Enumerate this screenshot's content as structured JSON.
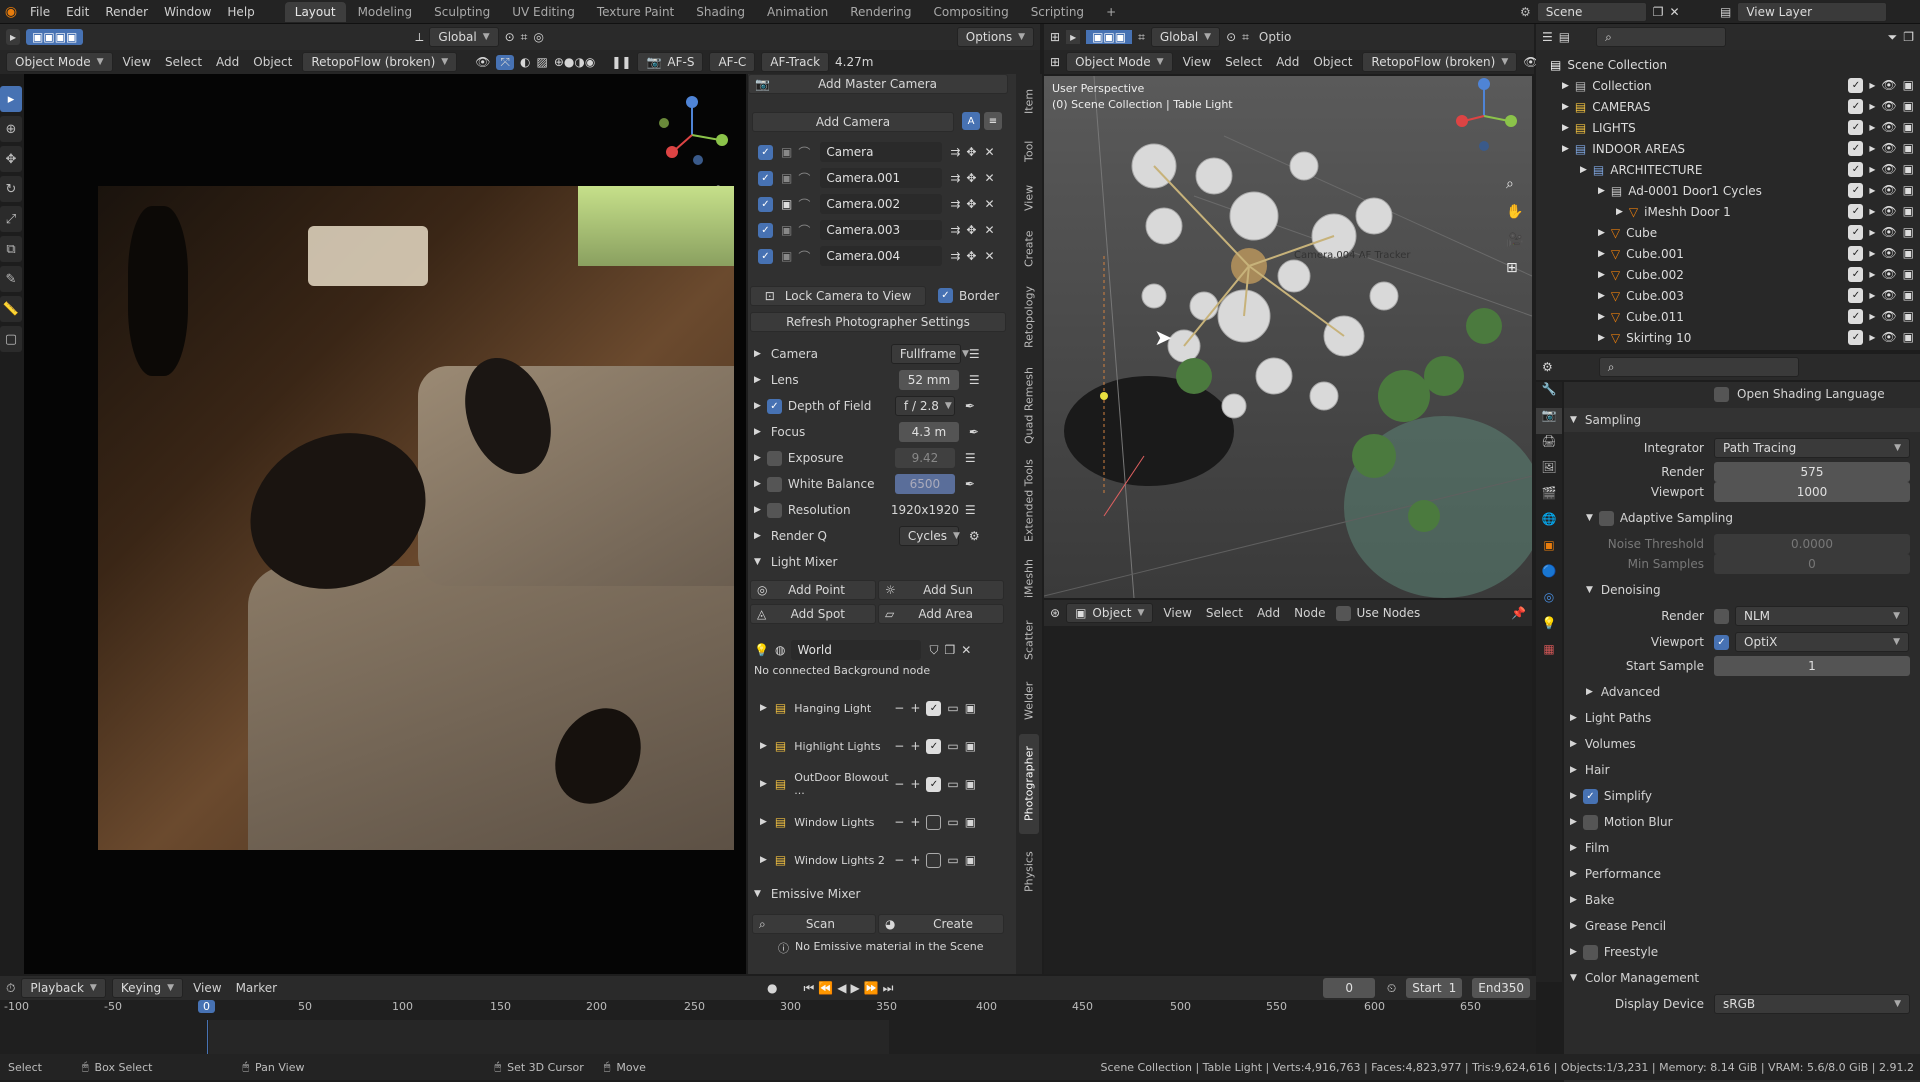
{
  "menu": [
    "File",
    "Edit",
    "Render",
    "Window",
    "Help"
  ],
  "workspaces": [
    "Layout",
    "Modeling",
    "Sculpting",
    "UV Editing",
    "Texture Paint",
    "Shading",
    "Animation",
    "Rendering",
    "Compositing",
    "Scripting"
  ],
  "active_workspace": "Layout",
  "scene": "Scene",
  "view_layer": "View Layer",
  "vp1": {
    "global": "Global",
    "options": "Options",
    "mode": "Object Mode",
    "menus": [
      "View",
      "Select",
      "Add",
      "Object"
    ],
    "retopo": "RetopoFlow (broken)",
    "af_s": "AF-S",
    "af_c": "AF-C",
    "af_track": "AF-Track",
    "distance": "4.27m"
  },
  "panel": {
    "add_master_camera": "Add Master Camera",
    "add_camera": "Add Camera",
    "cameras": [
      "Camera",
      "Camera.001",
      "Camera.002",
      "Camera.003",
      "Camera.004"
    ],
    "lock_camera": "Lock Camera to View",
    "border": "Border",
    "refresh": "Refresh Photographer Settings",
    "props": [
      {
        "label": "Camera",
        "value": "Fullframe",
        "check": false
      },
      {
        "label": "Lens",
        "value": "52 mm",
        "check": false
      },
      {
        "label": "Depth of Field",
        "value": "f / 2.8",
        "check": true
      },
      {
        "label": "Focus",
        "value": "4.3 m",
        "check": false
      },
      {
        "label": "Exposure",
        "value": "9.42",
        "check": false
      },
      {
        "label": "White Balance",
        "value": "6500",
        "check": false
      },
      {
        "label": "Resolution",
        "value": "1920x1920",
        "check": false
      },
      {
        "label": "Render Q",
        "value": "Cycles",
        "check": false
      }
    ],
    "light_mixer": "Light Mixer",
    "add_point": "Add Point",
    "add_sun": "Add Sun",
    "add_spot": "Add Spot",
    "add_area": "Add Area",
    "world": "World",
    "no_bg": "No connected Background node",
    "lights": [
      "Hanging Light",
      "Highlight Lights",
      "OutDoor Blowout ...",
      "Window Lights",
      "Window Lights 2"
    ],
    "emissive_mixer": "Emissive Mixer",
    "scan": "Scan",
    "create": "Create",
    "no_emissive": "No Emissive material in the Scene"
  },
  "vtabs": [
    "Item",
    "Tool",
    "View",
    "Create",
    "Retopology",
    "Quad Remesh",
    "Extended Tools",
    "iMeshh",
    "Scatter",
    "Welder",
    "Photographer",
    "Physics"
  ],
  "vp2": {
    "mode": "Object Mode",
    "menus": [
      "View",
      "Select",
      "Add",
      "Object"
    ],
    "retopo": "RetopoFlow (broken)",
    "global": "Global",
    "options": "Optio",
    "perspective": "User Perspective",
    "collection": "(0) Scene Collection | Table Light",
    "tracker": "Camera.004 AF Tracker"
  },
  "node_editor": {
    "type": "Object",
    "menus": [
      "View",
      "Select",
      "Add",
      "Node"
    ],
    "use_nodes": "Use Nodes"
  },
  "outliner": {
    "rows": [
      {
        "label": "Scene Collection",
        "indent": 0
      },
      {
        "label": "Collection",
        "indent": 1
      },
      {
        "label": "CAMERAS",
        "indent": 1
      },
      {
        "label": "LIGHTS",
        "indent": 1
      },
      {
        "label": "INDOOR AREAS",
        "indent": 1
      },
      {
        "label": "ARCHITECTURE",
        "indent": 2
      },
      {
        "label": "Ad-0001 Door1 Cycles",
        "indent": 3
      },
      {
        "label": "iMeshh Door 1",
        "indent": 4
      },
      {
        "label": "Cube",
        "indent": 3
      },
      {
        "label": "Cube.001",
        "indent": 3
      },
      {
        "label": "Cube.002",
        "indent": 3
      },
      {
        "label": "Cube.003",
        "indent": 3
      },
      {
        "label": "Cube.011",
        "indent": 3
      },
      {
        "label": "Skirting 10",
        "indent": 3
      }
    ]
  },
  "props": {
    "open_shading": "Open Shading Language",
    "sampling": "Sampling",
    "integrator_label": "Integrator",
    "integrator": "Path Tracing",
    "render_label": "Render",
    "render": "575",
    "viewport_label": "Viewport",
    "viewport": "1000",
    "adaptive": "Adaptive Sampling",
    "noise_label": "Noise Threshold",
    "noise": "0.0000",
    "min_label": "Min Samples",
    "min": "0",
    "denoising": "Denoising",
    "dn_render_label": "Render",
    "dn_render": "NLM",
    "dn_viewport_label": "Viewport",
    "dn_viewport": "OptiX",
    "start_label": "Start Sample",
    "start": "1",
    "advanced": "Advanced",
    "sections": [
      "Light Paths",
      "Volumes",
      "Hair",
      "Simplify",
      "Motion Blur",
      "Film",
      "Performance",
      "Bake",
      "Grease Pencil",
      "Freestyle",
      "Color Management"
    ],
    "display_label": "Display Device",
    "display": "sRGB"
  },
  "timeline": {
    "menus": [
      "Playback",
      "Keying",
      "View",
      "Marker"
    ],
    "frame": "0",
    "start_label": "Start",
    "start": "1",
    "end_label": "End",
    "end": "350",
    "ticks": [
      "-100",
      "-50",
      "0",
      "50",
      "100",
      "150",
      "200",
      "250",
      "300",
      "350",
      "400",
      "450",
      "500",
      "550",
      "600",
      "650"
    ]
  },
  "status": {
    "select": "Select",
    "box": "Box Select",
    "pan": "Pan View",
    "cursor": "Set 3D Cursor",
    "move": "Move",
    "info": "Scene Collection | Table Light | Verts:4,916,763 | Faces:4,823,977 | Tris:9,624,616 | Objects:1/3,231 | Memory: 8.14 GiB | VRAM: 5.6/8.0 GiB | 2.91.2"
  }
}
